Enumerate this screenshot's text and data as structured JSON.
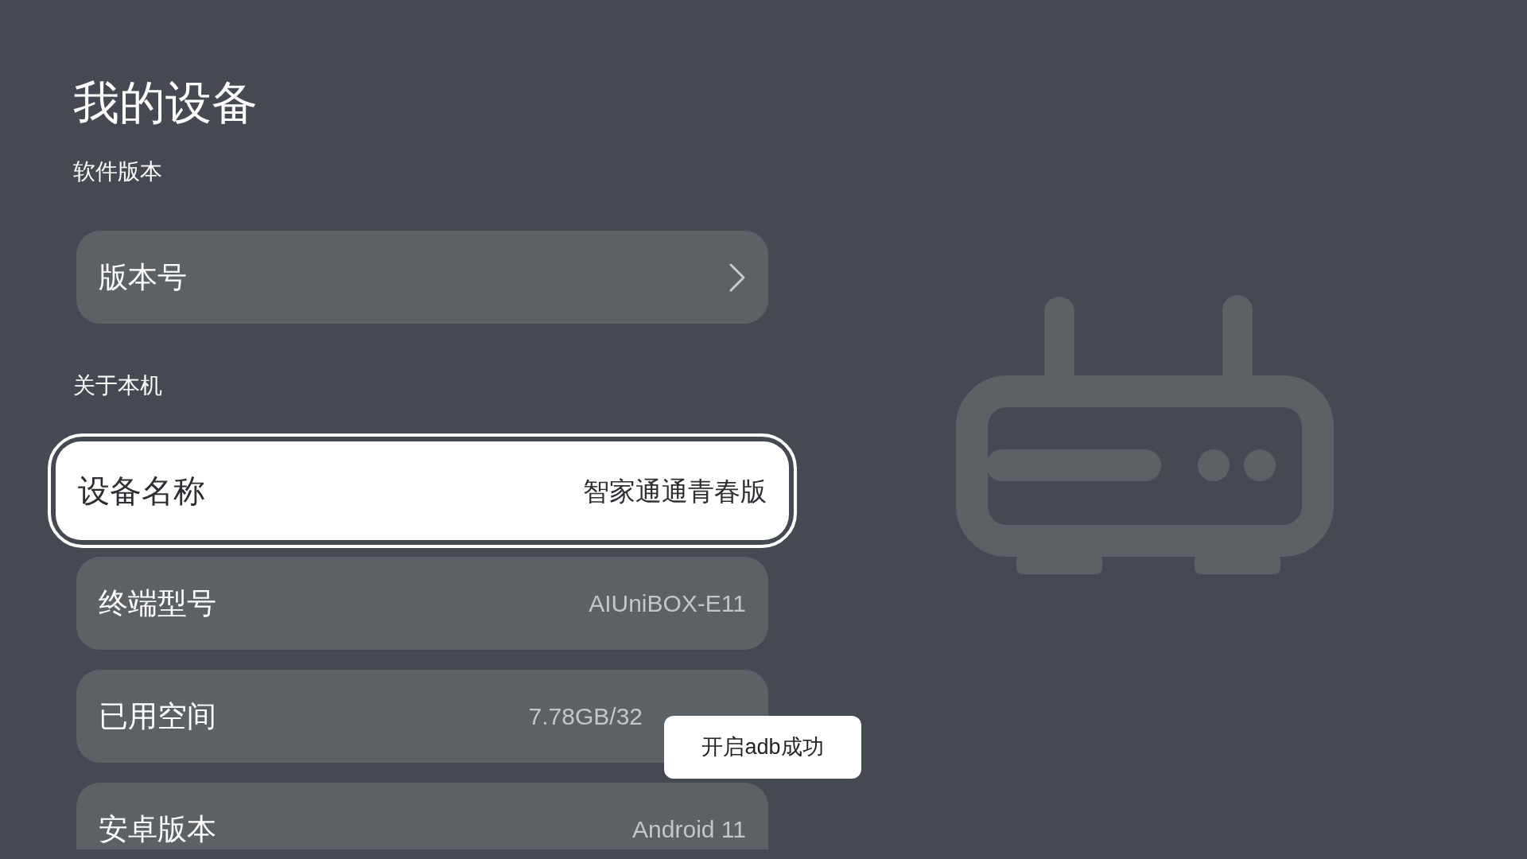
{
  "title": "我的设备",
  "sections": [
    {
      "heading": "软件版本",
      "items": [
        {
          "kind": "link",
          "label": "版本号",
          "selected": false
        }
      ]
    },
    {
      "heading": "关于本机",
      "items": [
        {
          "kind": "info",
          "label": "设备名称",
          "value": "智家通通青春版",
          "selected": true
        },
        {
          "kind": "info",
          "label": "终端型号",
          "value": "AIUniBOX-E11",
          "selected": false
        },
        {
          "kind": "info",
          "label": "已用空间",
          "value": "7.78GB/32",
          "covered": true,
          "selected": false
        },
        {
          "kind": "info",
          "label": "安卓版本",
          "value": "Android 11",
          "selected": false
        }
      ]
    }
  ],
  "toast": "开启adb成功"
}
